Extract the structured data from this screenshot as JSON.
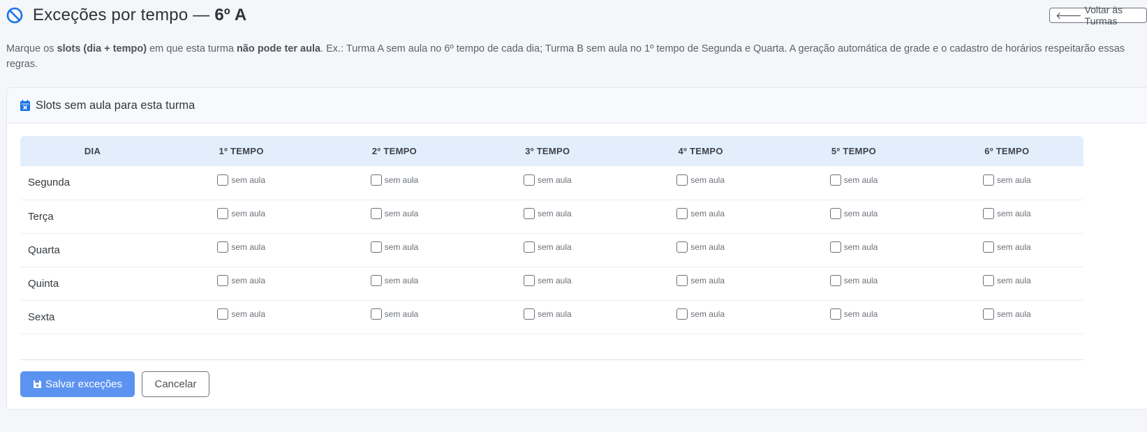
{
  "header": {
    "title_prefix": "Exceções por tempo — ",
    "title_class": "6º A",
    "back_label": "Voltar às Turmas"
  },
  "intro": {
    "t1": "Marque os ",
    "b1": "slots (dia + tempo)",
    "t2": " em que esta turma ",
    "b2": "não pode ter aula",
    "t3": ". Ex.: Turma A sem aula no 6º tempo de cada dia; Turma B sem aula no 1º tempo de Segunda e Quarta. A geração automática de grade e o cadastro de horários respeitarão essas regras."
  },
  "card": {
    "title": "Slots sem aula para esta turma"
  },
  "table": {
    "headers": [
      "DIA",
      "1º TEMPO",
      "2º TEMPO",
      "3º TEMPO",
      "4º TEMPO",
      "5º TEMPO",
      "6º TEMPO"
    ],
    "slot_label": "sem aula",
    "rows": [
      {
        "day": "Segunda",
        "checked": [
          false,
          false,
          false,
          false,
          false,
          false
        ]
      },
      {
        "day": "Terça",
        "checked": [
          false,
          false,
          false,
          false,
          false,
          false
        ]
      },
      {
        "day": "Quarta",
        "checked": [
          false,
          false,
          false,
          false,
          false,
          false
        ]
      },
      {
        "day": "Quinta",
        "checked": [
          false,
          false,
          false,
          false,
          false,
          false
        ]
      },
      {
        "day": "Sexta",
        "checked": [
          false,
          false,
          false,
          false,
          false,
          false
        ]
      }
    ]
  },
  "footer": {
    "save_label": "Salvar exceções",
    "cancel_label": "Cancelar"
  },
  "colors": {
    "accent": "#5d93f0",
    "ban_icon": "#1a73e8",
    "table_header_bg": "#e2eefc"
  },
  "icons": {
    "title": "ban-icon",
    "back": "arrow-left-icon",
    "card": "calendar-x-icon",
    "save": "floppy-disk-icon"
  }
}
